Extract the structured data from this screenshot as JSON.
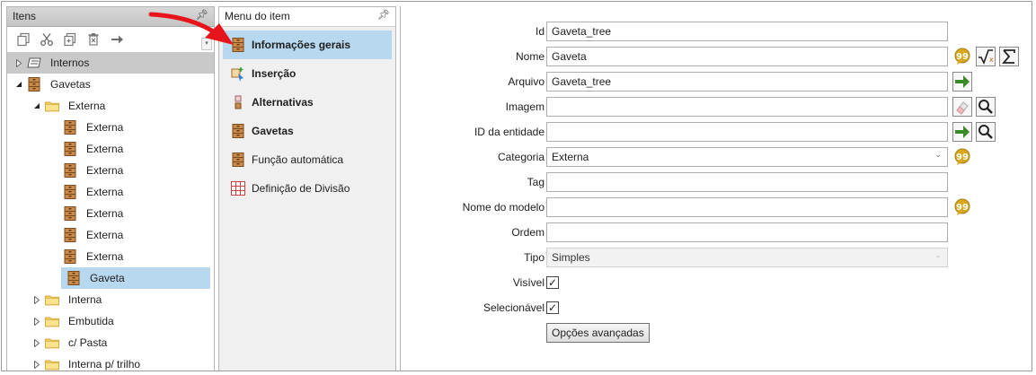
{
  "left_panel": {
    "title": "Itens",
    "tree": [
      {
        "label": "Internos",
        "icon": "layers-icon",
        "expander": "closed",
        "level": 0,
        "header": true
      },
      {
        "label": "Gavetas",
        "icon": "drawer-icon",
        "expander": "open",
        "level": 0
      },
      {
        "label": "Externa",
        "icon": "folder-icon",
        "expander": "open",
        "level": 1
      },
      {
        "label": "Externa",
        "icon": "drawer-icon",
        "expander": "none",
        "level": 2
      },
      {
        "label": "Externa",
        "icon": "drawer-icon",
        "expander": "none",
        "level": 2
      },
      {
        "label": "Externa",
        "icon": "drawer-icon",
        "expander": "none",
        "level": 2
      },
      {
        "label": "Externa",
        "icon": "drawer-icon",
        "expander": "none",
        "level": 2
      },
      {
        "label": "Externa",
        "icon": "drawer-icon",
        "expander": "none",
        "level": 2
      },
      {
        "label": "Externa",
        "icon": "drawer-icon",
        "expander": "none",
        "level": 2
      },
      {
        "label": "Externa",
        "icon": "drawer-icon",
        "expander": "none",
        "level": 2
      },
      {
        "label": "Gaveta",
        "icon": "drawer-icon",
        "expander": "none",
        "level": 2,
        "selected": true
      },
      {
        "label": "Interna",
        "icon": "folder-icon",
        "expander": "closed",
        "level": 1
      },
      {
        "label": "Embutida",
        "icon": "folder-icon",
        "expander": "closed",
        "level": 1
      },
      {
        "label": "c/ Pasta",
        "icon": "folder-icon",
        "expander": "closed",
        "level": 1
      },
      {
        "label": "Interna p/ trilho",
        "icon": "folder-icon",
        "expander": "closed",
        "level": 1
      }
    ]
  },
  "menu_panel": {
    "title": "Menu do item",
    "items": [
      {
        "label": "Informações gerais",
        "icon": "drawer-icon",
        "active": true,
        "bold": true
      },
      {
        "label": "Inserção",
        "icon": "insert-icon",
        "bold": true
      },
      {
        "label": "Alternativas",
        "icon": "alternatives-icon",
        "bold": true
      },
      {
        "label": "Gavetas",
        "icon": "drawer-icon",
        "bold": true
      },
      {
        "label": "Função automática",
        "icon": "drawer-icon",
        "bold": false
      },
      {
        "label": "Definição de Divisão",
        "icon": "grid-icon",
        "bold": false
      }
    ]
  },
  "form": {
    "id_label": "Id",
    "id_value": "Gaveta_tree",
    "nome_label": "Nome",
    "nome_value": "Gaveta",
    "arquivo_label": "Arquivo",
    "arquivo_value": "Gaveta_tree",
    "imagem_label": "Imagem",
    "imagem_value": "",
    "entidade_label": "ID da entidade",
    "entidade_value": "",
    "categoria_label": "Categoria",
    "categoria_value": "Externa",
    "tag_label": "Tag",
    "tag_value": "",
    "modelo_label": "Nome do modelo",
    "modelo_value": "",
    "ordem_label": "Ordem",
    "ordem_value": "",
    "tipo_label": "Tipo",
    "tipo_value": "Simples",
    "visivel_label": "Visível",
    "visivel_checked": true,
    "selecionavel_label": "Selecionável",
    "selecionavel_checked": true,
    "advanced_button": "Opções avançadas",
    "check_glyph": "✓",
    "dropdown_glyph": "⌄"
  },
  "colors": {
    "selection": "#b7d8ef",
    "annotation_arrow": "#e8141b"
  }
}
